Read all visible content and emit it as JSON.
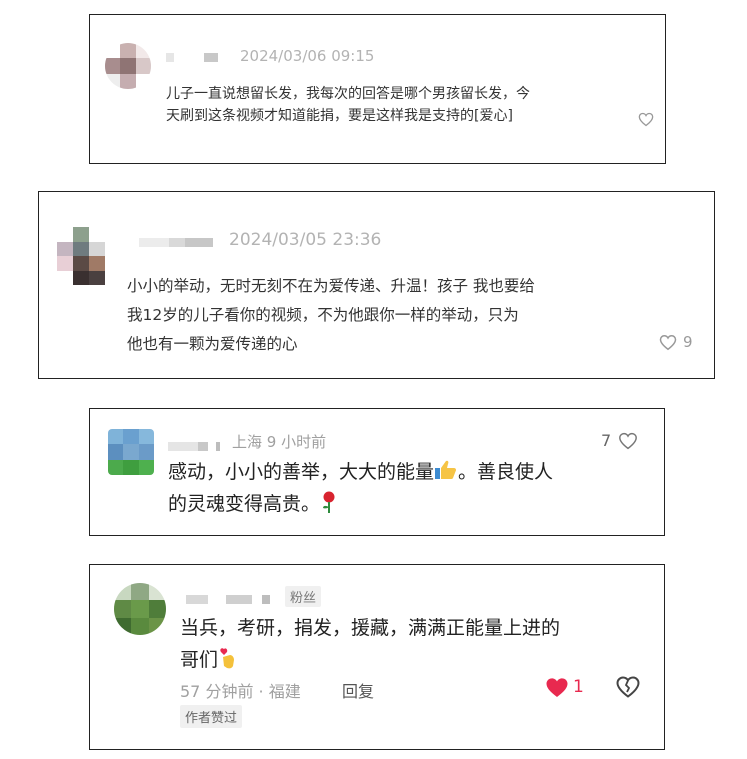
{
  "comment1": {
    "timestamp": "2024/03/06 09:15",
    "lines": [
      "儿子一直说想留长发，我每次的回答是哪个男孩留长发，今",
      "天刷到这条视频才知道能捐，要是这样我是支持的[爱心]"
    ],
    "icon": "heart-outline-icon"
  },
  "comment2": {
    "timestamp": "2024/03/05 23:36",
    "lines": [
      "小小的举动，无时无刻不在为爱传递、升温！孩子 我也要给",
      "我12岁的儿子看你的视频，不为他跟你一样的举动，只为",
      "他也有一颗为爱传递的心"
    ],
    "like_count": "9",
    "icon": "heart-outline-icon"
  },
  "comment3": {
    "meta": "上海 9 小时前",
    "like_count": "7",
    "lines": [
      "感动，小小的善举，大大的能量",
      "。善良使人",
      "的灵魂变得高贵。"
    ],
    "emoji": [
      "thumbs-up-icon",
      "rose-icon"
    ]
  },
  "comment4": {
    "fan_badge": "粉丝",
    "lines": [
      "当兵，考研，捐发，援藏，满满正能量上进的",
      "哥们"
    ],
    "emoji": "fingers-heart-icon",
    "meta": "57 分钟前 · 福建",
    "reply_label": "回复",
    "like_count": "1",
    "author_badge": "作者赞过",
    "accent_color": "#e8294f"
  }
}
